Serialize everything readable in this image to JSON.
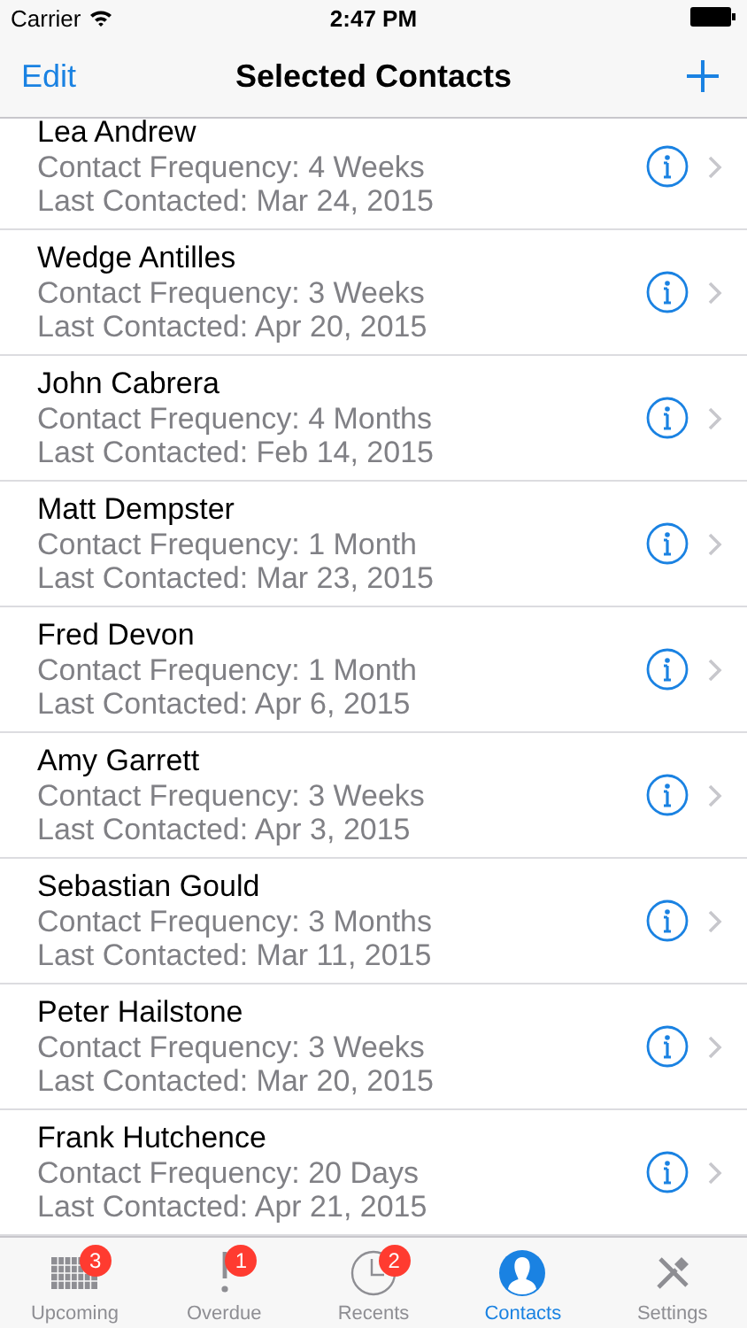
{
  "status_bar": {
    "carrier": "Carrier",
    "time": "2:47 PM"
  },
  "nav": {
    "left": "Edit",
    "title": "Selected Contacts"
  },
  "contacts": [
    {
      "name": "Lea Andrew",
      "frequency": "Contact Frequency: 4 Weeks",
      "last": "Last Contacted: Mar 24, 2015"
    },
    {
      "name": "Wedge Antilles",
      "frequency": "Contact Frequency: 3 Weeks",
      "last": "Last Contacted: Apr 20, 2015"
    },
    {
      "name": "John Cabrera",
      "frequency": "Contact Frequency: 4 Months",
      "last": "Last Contacted: Feb 14, 2015"
    },
    {
      "name": "Matt Dempster",
      "frequency": "Contact Frequency: 1 Month",
      "last": "Last Contacted: Mar 23, 2015"
    },
    {
      "name": "Fred Devon",
      "frequency": "Contact Frequency: 1 Month",
      "last": "Last Contacted: Apr 6, 2015"
    },
    {
      "name": "Amy Garrett",
      "frequency": "Contact Frequency: 3 Weeks",
      "last": "Last Contacted: Apr 3, 2015"
    },
    {
      "name": "Sebastian Gould",
      "frequency": "Contact Frequency: 3 Months",
      "last": "Last Contacted: Mar 11, 2015"
    },
    {
      "name": "Peter Hailstone",
      "frequency": "Contact Frequency: 3 Weeks",
      "last": "Last Contacted: Mar 20, 2015"
    },
    {
      "name": "Frank Hutchence",
      "frequency": "Contact Frequency: 20 Days",
      "last": "Last Contacted: Apr 21, 2015"
    }
  ],
  "tabs": [
    {
      "kind": "calendar",
      "label": "Upcoming",
      "badge": "3",
      "selected": false
    },
    {
      "kind": "exclamation",
      "label": "Overdue",
      "badge": "1",
      "selected": false
    },
    {
      "kind": "clock",
      "label": "Recents",
      "badge": "2",
      "selected": false
    },
    {
      "kind": "person",
      "label": "Contacts",
      "selected": true
    },
    {
      "kind": "tools",
      "label": "Settings",
      "selected": false
    }
  ]
}
